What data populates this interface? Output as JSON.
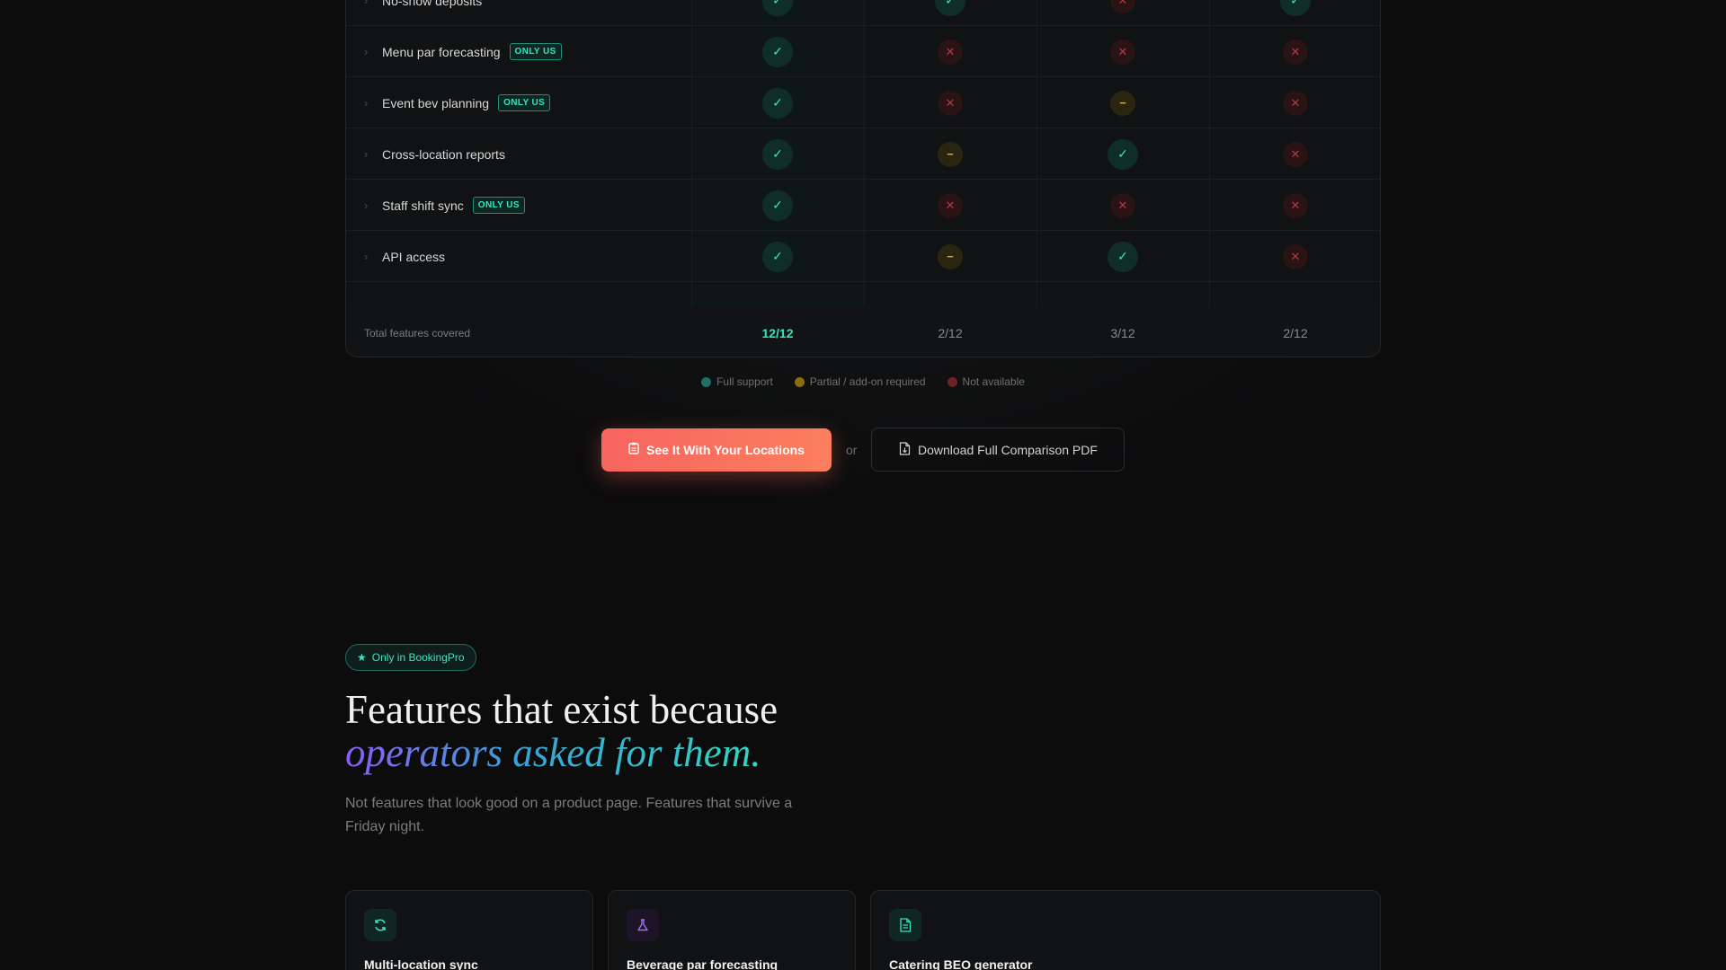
{
  "comparison": {
    "rows": [
      {
        "feature": "No-show deposits",
        "badge": "",
        "marks": [
          "full",
          "full",
          "none",
          "full"
        ]
      },
      {
        "feature": "Menu par forecasting",
        "badge": "ONLY US",
        "marks": [
          "full",
          "none",
          "none",
          "none"
        ]
      },
      {
        "feature": "Event bev planning",
        "badge": "ONLY US",
        "marks": [
          "full",
          "none",
          "partial",
          "none"
        ]
      },
      {
        "feature": "Cross-location reports",
        "badge": "",
        "marks": [
          "full",
          "partial",
          "full",
          "none"
        ]
      },
      {
        "feature": "Staff shift sync",
        "badge": "ONLY US",
        "marks": [
          "full",
          "none",
          "none",
          "none"
        ]
      },
      {
        "feature": "API access",
        "badge": "",
        "marks": [
          "full",
          "partial",
          "full",
          "none"
        ]
      }
    ],
    "total_label": "Total features covered",
    "totals": [
      "12/12",
      "2/12",
      "3/12",
      "2/12"
    ]
  },
  "legend": {
    "full": "Full support",
    "partial": "Partial / add-on required",
    "none": "Not available"
  },
  "colors": {
    "full": "#1f6f66",
    "partial": "#8a6d12",
    "none": "#6e2227",
    "accent": "#2ee6c4",
    "cta": "#f7655f"
  },
  "cta": {
    "primary_label": "See It With Your Locations",
    "or_text": "or",
    "secondary_label": "Download Full Comparison PDF",
    "primary_icon": "clipboard-icon",
    "secondary_icon": "file-download-icon"
  },
  "features": {
    "pill": "Only in BookingPro",
    "heading_line1": "Features that exist because",
    "heading_line2": "operators asked for them.",
    "subtext": "Not features that look good on a product page. Features that survive a Friday night.",
    "cards": [
      {
        "title": "Multi-location sync",
        "icon": "refresh-icon"
      },
      {
        "title": "Beverage par forecasting",
        "icon": "flask-icon"
      },
      {
        "title": "Catering BEO generator",
        "icon": "document-icon"
      }
    ]
  }
}
